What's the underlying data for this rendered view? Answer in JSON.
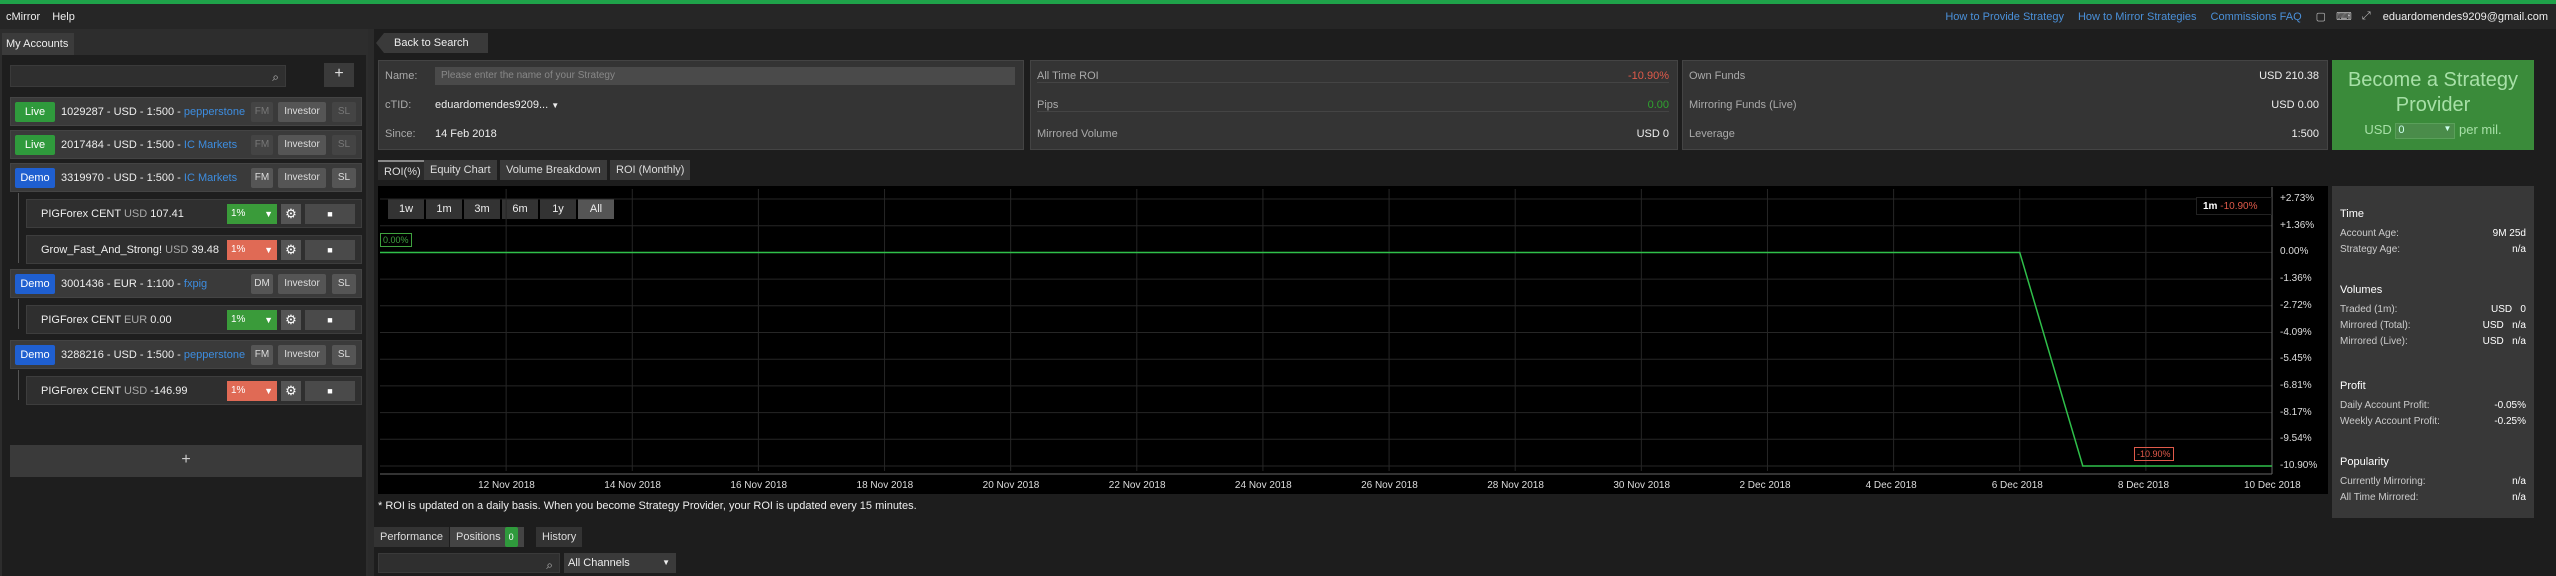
{
  "menubar": {
    "items": [
      "cMirror",
      "Help"
    ],
    "links": [
      "How to Provide Strategy",
      "How to Mirror Strategies",
      "Commissions FAQ"
    ],
    "user": "eduardomendes9209@gmail.com"
  },
  "sidebar": {
    "tab": "My Accounts",
    "add_label": "+",
    "add_account_label": "+",
    "accounts": [
      {
        "type": "Live",
        "text": "1029287 - USD - 1:500 - ",
        "broker": "pepperstone",
        "fm": "FM",
        "investor": "Investor",
        "sl": "SL"
      },
      {
        "type": "Live",
        "text": "2017484 - USD - 1:500 - ",
        "broker": "IC Markets",
        "fm": "FM",
        "investor": "Investor",
        "sl": "SL"
      },
      {
        "type": "Demo",
        "text": "3319970 - USD - 1:500 - ",
        "broker": "IC Markets",
        "fm": "FM",
        "investor": "Investor",
        "sl": "SL"
      },
      {
        "type": "Demo",
        "text": "3001436 - EUR - 1:100 - ",
        "broker": "fxpig",
        "fm": "DM",
        "investor": "Investor",
        "sl": "SL"
      },
      {
        "type": "Demo",
        "text": "3288216 - USD - 1:500 - ",
        "broker": "pepperstone",
        "fm": "FM",
        "investor": "Investor",
        "sl": "SL"
      }
    ],
    "strategies": [
      {
        "name": "PIGForex CENT",
        "cur": "USD",
        "val": "107.41",
        "pct": "1%"
      },
      {
        "name": "Grow_Fast_And_Strong!",
        "cur": "USD",
        "val": "39.48",
        "pct": "1%"
      },
      {
        "name": "PIGForex CENT",
        "cur": "EUR",
        "val": "0.00",
        "pct": "1%"
      },
      {
        "name": "PIGForex CENT",
        "cur": "USD",
        "val": "-146.99",
        "pct": "1%"
      }
    ]
  },
  "back_label": "Back to Search",
  "info": {
    "name_label": "Name:",
    "name_placeholder": "Please enter the name of your Strategy",
    "ctid_label": "cTID:",
    "ctid_value": "eduardomendes9209...",
    "since_label": "Since:",
    "since_value": "14 Feb 2018"
  },
  "stats": {
    "roi_label": "All Time ROI",
    "roi_value": "-10.90%",
    "pips_label": "Pips",
    "pips_value": "0.00",
    "mv_label": "Mirrored Volume",
    "mv_value": "USD 0"
  },
  "funds": {
    "own_label": "Own Funds",
    "own_value": "USD 210.38",
    "mf_label": "Mirroring Funds (Live)",
    "mf_value": "USD 0.00",
    "lev_label": "Leverage",
    "lev_value": "1:500"
  },
  "become": {
    "title": "Become a Strategy Provider",
    "usd": "USD",
    "sel": "0",
    "per": "per mil."
  },
  "tabs": [
    "ROI(%)",
    "Equity Chart",
    "Volume Breakdown",
    "ROI (Monthly)"
  ],
  "ranges": [
    "1w",
    "1m",
    "3m",
    "6m",
    "1y",
    "All"
  ],
  "legend": {
    "period": "1m",
    "value": "-10.90%"
  },
  "chart_data": {
    "type": "line",
    "x": [
      "2018-11-10",
      "2018-12-06",
      "2018-12-07",
      "2018-12-10"
    ],
    "series": [
      {
        "values": [
          0,
          0,
          -10.9,
          -10.9
        ]
      }
    ],
    "xticks": [
      "12 Nov 2018",
      "14 Nov 2018",
      "16 Nov 2018",
      "18 Nov 2018",
      "20 Nov 2018",
      "22 Nov 2018",
      "24 Nov 2018",
      "26 Nov 2018",
      "28 Nov 2018",
      "30 Nov 2018",
      "2 Dec 2018",
      "4 Dec 2018",
      "6 Dec 2018",
      "8 Dec 2018",
      "10 Dec 2018"
    ],
    "yticks": [
      "+2.73%",
      "+1.36%",
      "0.00%",
      "-1.36%",
      "-2.72%",
      "-4.09%",
      "-5.45%",
      "-6.81%",
      "-8.17%",
      "-9.54%",
      "-10.90%"
    ],
    "ylim": [
      -10.9,
      2.73
    ],
    "start_label": "0.00%",
    "end_label": "-10.90%",
    "grid": true
  },
  "note": "* ROI is updated on a daily basis. When you become Strategy Provider, your ROI is updated every 15 minutes.",
  "side": {
    "time_h": "Time",
    "age_l": "Account Age:",
    "age_v": "9M 25d",
    "sage_l": "Strategy Age:",
    "sage_v": "n/a",
    "vol_h": "Volumes",
    "tr_l": "Traded (1m):",
    "tr_v": "USD   0",
    "mt_l": "Mirrored (Total):",
    "mt_v": "USD   n/a",
    "ml_l": "Mirrored (Live):",
    "ml_v": "USD   n/a",
    "profit_h": "Profit",
    "dp_l": "Daily Account Profit:",
    "dp_v": "-0.05%",
    "wp_l": "Weekly Account Profit:",
    "wp_v": "-0.25%",
    "pop_h": "Popularity",
    "cm_l": "Currently Mirroring:",
    "cm_v": "n/a",
    "atm_l": "All Time Mirrored:",
    "atm_v": "n/a"
  },
  "bottom_tabs": {
    "perf": "Performance",
    "pos": "Positions",
    "pos_count": "0",
    "hist": "History",
    "channels": "All Channels"
  }
}
